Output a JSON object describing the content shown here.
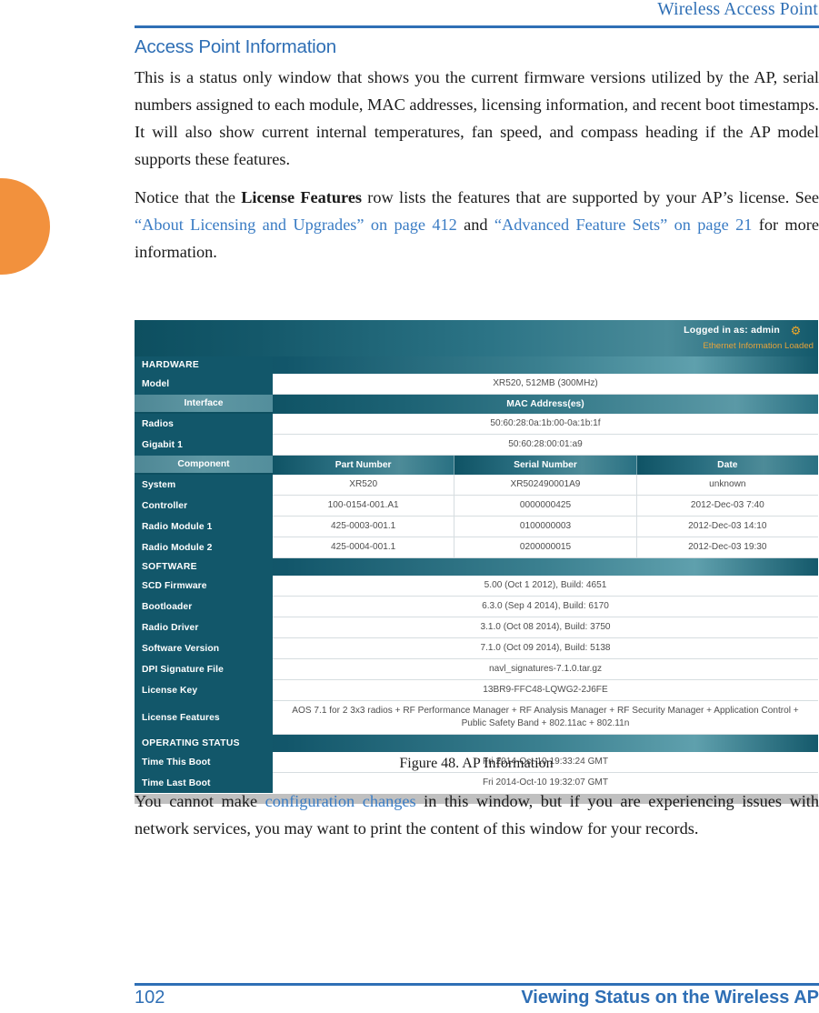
{
  "running_header": {
    "text": "Wireless Access Point"
  },
  "page": {
    "section_title": "Access Point Information",
    "paragraph_1": "This is a status only window that shows you the current firmware versions utilized by the AP, serial numbers assigned to each module, MAC addresses, licensing information, and recent boot timestamps. It will also show current internal temperatures, fan speed, and compass heading if the AP model supports these features.",
    "paragraph_2": {
      "part_1": "Notice that the ",
      "bold_1": "License Features",
      "part_2": " row lists the features that are supported by your AP’s license. See ",
      "link_1": "“About Licensing and Upgrades” on page 412",
      "part_3": " and ",
      "link_2": "“Advanced Feature Sets” on page 21",
      "part_4": " for more information."
    },
    "figure_caption": "Figure 48. AP Information",
    "paragraph_3": {
      "part_1": "You cannot make ",
      "link_1": "configuration changes",
      "part_2": " in this window, but if you are experiencing issues with network services, you may want to print the content of this window for your records."
    }
  },
  "screenshot": {
    "topbar": {
      "logged_in": "Logged in as: admin",
      "gear_icon": "gear-icon",
      "status_message": "Ethernet Information Loaded"
    },
    "sections": {
      "hardware": "HARDWARE",
      "software": "SOFTWARE",
      "operating_status": "OPERATING STATUS"
    },
    "hardware": {
      "model": {
        "label": "Model",
        "value": "XR520, 512MB (300MHz)"
      },
      "interface_header": {
        "label": "Interface",
        "column": "MAC Address(es)"
      },
      "interfaces": [
        {
          "label": "Radios",
          "value": "50:60:28:0a:1b:00-0a:1b:1f"
        },
        {
          "label": "Gigabit 1",
          "value": "50:60:28:00:01:a9"
        }
      ],
      "component_header": {
        "label": "Component",
        "columns": [
          "Part Number",
          "Serial Number",
          "Date"
        ]
      },
      "components": [
        {
          "label": "System",
          "part_number": "XR520",
          "serial_number": "XR502490001A9",
          "date": "unknown"
        },
        {
          "label": "Controller",
          "part_number": "100-0154-001.A1",
          "serial_number": "0000000425",
          "date": "2012-Dec-03 7:40"
        },
        {
          "label": "Radio Module 1",
          "part_number": "425-0003-001.1",
          "serial_number": "0100000003",
          "date": "2012-Dec-03 14:10"
        },
        {
          "label": "Radio Module 2",
          "part_number": "425-0004-001.1",
          "serial_number": "0200000015",
          "date": "2012-Dec-03 19:30"
        }
      ]
    },
    "software": [
      {
        "label": "SCD Firmware",
        "value": "5.00 (Oct 1 2012), Build: 4651"
      },
      {
        "label": "Bootloader",
        "value": "6.3.0 (Sep 4 2014), Build: 6170"
      },
      {
        "label": "Radio Driver",
        "value": "3.1.0 (Oct 08 2014), Build: 3750"
      },
      {
        "label": "Software Version",
        "value": "7.1.0 (Oct 09 2014), Build: 5138"
      },
      {
        "label": "DPI Signature File",
        "value": "navl_signatures-7.1.0.tar.gz"
      },
      {
        "label": "License Key",
        "value": "13BR9-FFC48-LQWG2-2J6FE"
      },
      {
        "label": "License Features",
        "value": "AOS 7.1 for 2 3x3 radios + RF Performance Manager + RF Analysis Manager + RF Security Manager + Application Control + Public Safety Band + 802.11ac + 802.11n"
      }
    ],
    "operating_status": [
      {
        "label": "Time This Boot",
        "value": "Fri 2014-Oct-10 19:33:24 GMT"
      },
      {
        "label": "Time Last Boot",
        "value": "Fri 2014-Oct-10 19:32:07 GMT"
      }
    ]
  },
  "footer": {
    "page_number": "102",
    "section": "Viewing Status on the Wireless AP"
  },
  "colors": {
    "accent_blue": "#2f6fb5",
    "link_blue": "#3a7cc4",
    "orange_tab": "#f2913d",
    "teal_dark": "#12576a",
    "teal_light": "#5f97a3",
    "status_orange": "#e5a33b"
  }
}
